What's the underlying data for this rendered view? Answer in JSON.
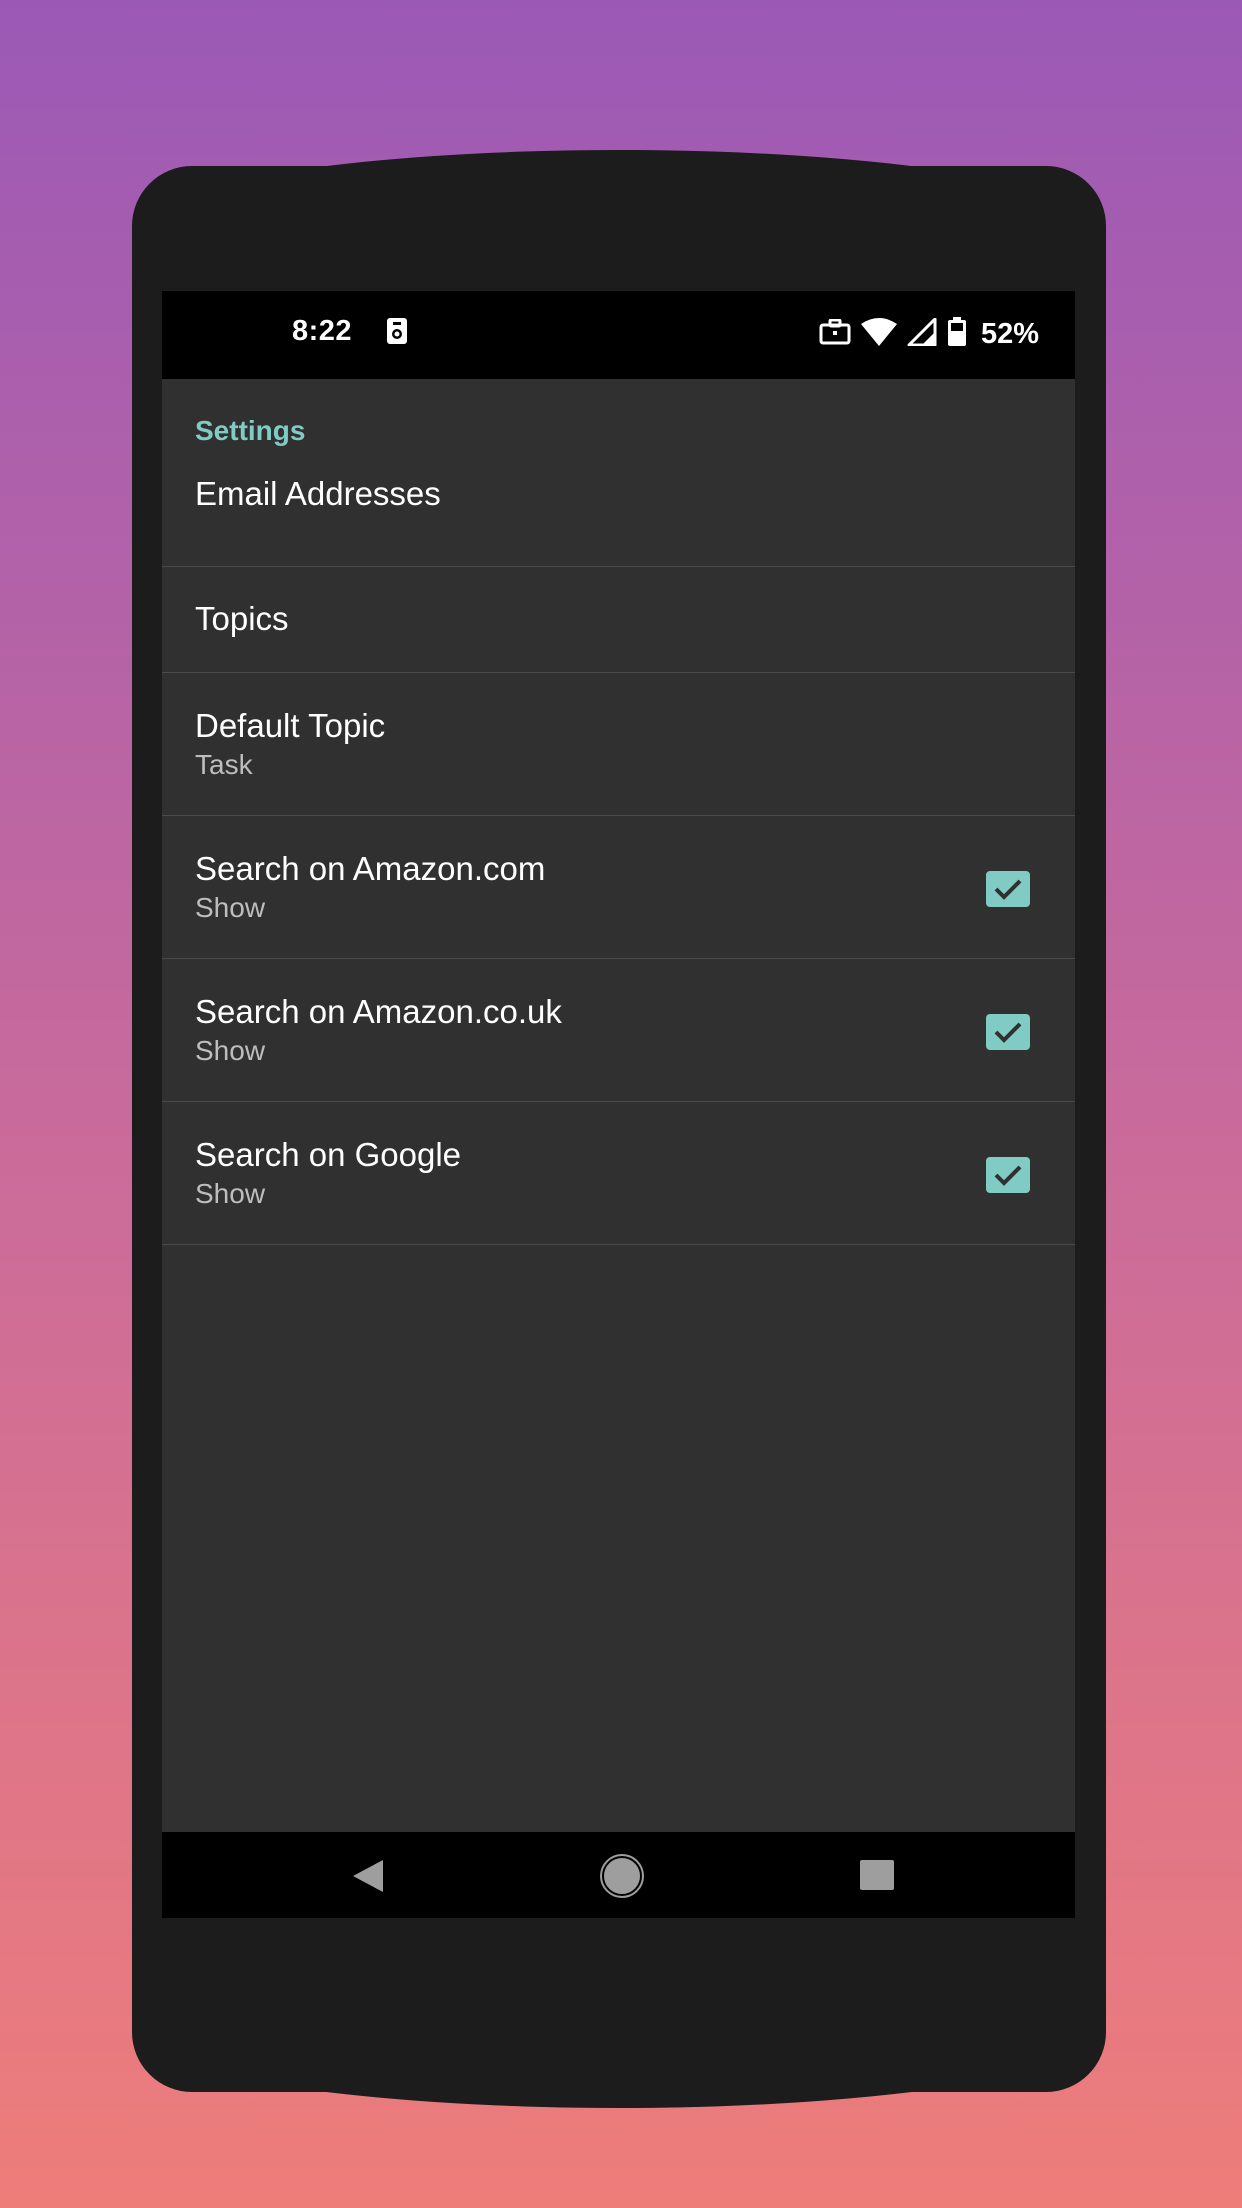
{
  "status_bar": {
    "time": "8:22",
    "battery": "52%",
    "icons": [
      "camera-icon",
      "briefcase-icon",
      "wifi-icon",
      "signal-icon",
      "battery-icon"
    ]
  },
  "settings": {
    "section_title": "Settings",
    "items": [
      {
        "title": "Email Addresses",
        "summary": "",
        "checkbox": null
      },
      {
        "title": "Topics",
        "summary": "",
        "checkbox": null
      },
      {
        "title": "Default Topic",
        "summary": "Task",
        "checkbox": null
      },
      {
        "title": "Search on Amazon.com",
        "summary": "Show",
        "checkbox": true
      },
      {
        "title": "Search on Amazon.co.uk",
        "summary": "Show",
        "checkbox": true
      },
      {
        "title": "Search on Google",
        "summary": "Show",
        "checkbox": true
      }
    ]
  },
  "nav_bar": {
    "icons": [
      "back-icon",
      "home-icon",
      "recents-icon"
    ]
  },
  "colors": {
    "accent": "#80cbc4",
    "background": "#303030",
    "status_bar": "#000000"
  }
}
